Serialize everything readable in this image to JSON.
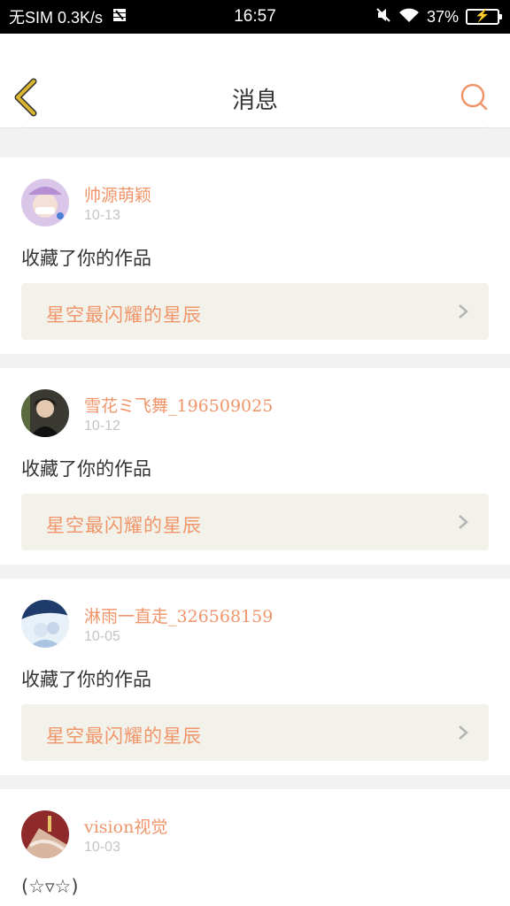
{
  "status_bar": {
    "carrier": "无SIM 0.3K/s",
    "time": "16:57",
    "battery": "37%"
  },
  "header": {
    "title": "消息"
  },
  "messages": [
    {
      "username": "帅源萌颖",
      "date": "10-13",
      "text": "收藏了你的作品",
      "work_title": "星空最闪耀的星辰"
    },
    {
      "username": "雪花ミ飞舞_196509025",
      "date": "10-12",
      "text": "收藏了你的作品",
      "work_title": "星空最闪耀的星辰"
    },
    {
      "username": "淋雨一直走_326568159",
      "date": "10-05",
      "text": "收藏了你的作品",
      "work_title": "星空最闪耀的星辰"
    },
    {
      "username": "vision视觉",
      "date": "10-03",
      "text": "(☆▿☆)"
    }
  ],
  "colors": {
    "accent": "#f0956a",
    "back_icon": "#d9b72e",
    "link_bg": "#f3f2ea"
  }
}
